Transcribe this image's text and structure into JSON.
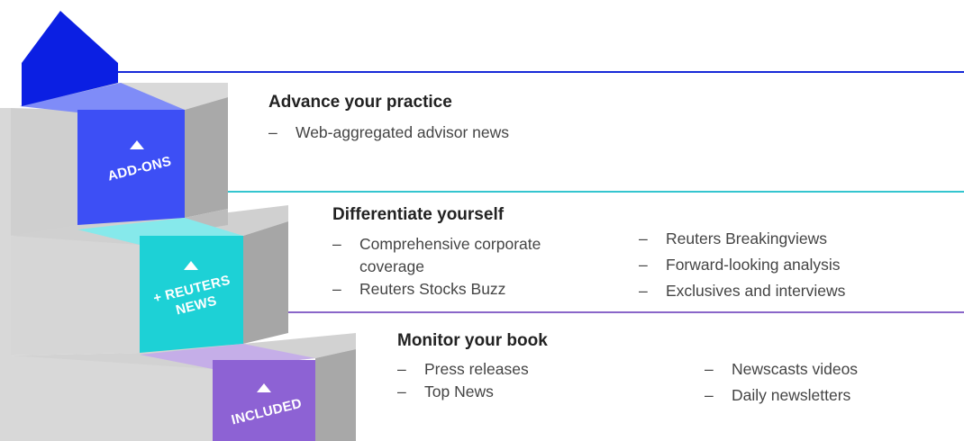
{
  "colors": {
    "addons": "#3d4ff5",
    "addons_top": "#7f8cf8",
    "reuters": "#1dd1d6",
    "reuters_top": "#86e9eb",
    "included": "#8d62d4",
    "included_top": "#c5aee8",
    "house": "#0b1fe3",
    "line_addons": "#1729d8",
    "line_reuters": "#34c5cf",
    "line_included": "#8a66c9"
  },
  "steps": {
    "addons": {
      "label": "ADD-ONS"
    },
    "reuters": {
      "label_line1": "+ REUTERS",
      "label_line2": "NEWS"
    },
    "included": {
      "label": "INCLUDED"
    }
  },
  "tiers": {
    "addons": {
      "title": "Advance your practice",
      "col1": [
        "Web-aggregated advisor news"
      ]
    },
    "reuters": {
      "title": "Differentiate yourself",
      "col1": [
        "Comprehensive corporate coverage",
        "Reuters Stocks Buzz"
      ],
      "col2": [
        "Reuters Breakingviews",
        "Forward-looking analysis",
        "Exclusives and interviews"
      ]
    },
    "included": {
      "title": "Monitor your book",
      "col1": [
        "Press releases",
        "Top News"
      ],
      "col2": [
        "Newscasts videos",
        "Daily newsletters"
      ]
    }
  }
}
